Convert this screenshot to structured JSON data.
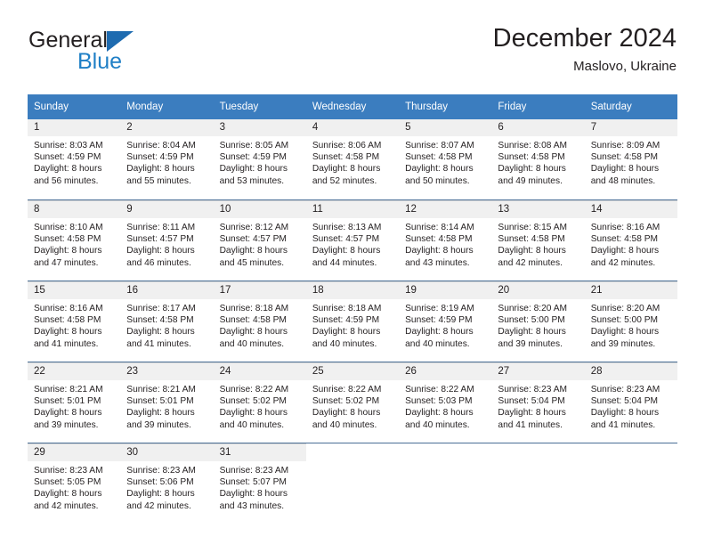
{
  "logo": {
    "word1": "General",
    "word2": "Blue",
    "triangle_color": "#1e6bb0",
    "blue_color": "#1f7fc6"
  },
  "header": {
    "title": "December 2024",
    "subtitle": "Maslovo, Ukraine"
  },
  "theme": {
    "header_row_bg": "#3b7dbf",
    "day_number_bg": "#f0f0f0",
    "week_separator": "#4a6f96",
    "text": "#231f20"
  },
  "weekday_headers": [
    "Sunday",
    "Monday",
    "Tuesday",
    "Wednesday",
    "Thursday",
    "Friday",
    "Saturday"
  ],
  "weeks": [
    [
      {
        "day": "1",
        "sunrise": "Sunrise: 8:03 AM",
        "sunset": "Sunset: 4:59 PM",
        "daylight1": "Daylight: 8 hours",
        "daylight2": "and 56 minutes."
      },
      {
        "day": "2",
        "sunrise": "Sunrise: 8:04 AM",
        "sunset": "Sunset: 4:59 PM",
        "daylight1": "Daylight: 8 hours",
        "daylight2": "and 55 minutes."
      },
      {
        "day": "3",
        "sunrise": "Sunrise: 8:05 AM",
        "sunset": "Sunset: 4:59 PM",
        "daylight1": "Daylight: 8 hours",
        "daylight2": "and 53 minutes."
      },
      {
        "day": "4",
        "sunrise": "Sunrise: 8:06 AM",
        "sunset": "Sunset: 4:58 PM",
        "daylight1": "Daylight: 8 hours",
        "daylight2": "and 52 minutes."
      },
      {
        "day": "5",
        "sunrise": "Sunrise: 8:07 AM",
        "sunset": "Sunset: 4:58 PM",
        "daylight1": "Daylight: 8 hours",
        "daylight2": "and 50 minutes."
      },
      {
        "day": "6",
        "sunrise": "Sunrise: 8:08 AM",
        "sunset": "Sunset: 4:58 PM",
        "daylight1": "Daylight: 8 hours",
        "daylight2": "and 49 minutes."
      },
      {
        "day": "7",
        "sunrise": "Sunrise: 8:09 AM",
        "sunset": "Sunset: 4:58 PM",
        "daylight1": "Daylight: 8 hours",
        "daylight2": "and 48 minutes."
      }
    ],
    [
      {
        "day": "8",
        "sunrise": "Sunrise: 8:10 AM",
        "sunset": "Sunset: 4:58 PM",
        "daylight1": "Daylight: 8 hours",
        "daylight2": "and 47 minutes."
      },
      {
        "day": "9",
        "sunrise": "Sunrise: 8:11 AM",
        "sunset": "Sunset: 4:57 PM",
        "daylight1": "Daylight: 8 hours",
        "daylight2": "and 46 minutes."
      },
      {
        "day": "10",
        "sunrise": "Sunrise: 8:12 AM",
        "sunset": "Sunset: 4:57 PM",
        "daylight1": "Daylight: 8 hours",
        "daylight2": "and 45 minutes."
      },
      {
        "day": "11",
        "sunrise": "Sunrise: 8:13 AM",
        "sunset": "Sunset: 4:57 PM",
        "daylight1": "Daylight: 8 hours",
        "daylight2": "and 44 minutes."
      },
      {
        "day": "12",
        "sunrise": "Sunrise: 8:14 AM",
        "sunset": "Sunset: 4:58 PM",
        "daylight1": "Daylight: 8 hours",
        "daylight2": "and 43 minutes."
      },
      {
        "day": "13",
        "sunrise": "Sunrise: 8:15 AM",
        "sunset": "Sunset: 4:58 PM",
        "daylight1": "Daylight: 8 hours",
        "daylight2": "and 42 minutes."
      },
      {
        "day": "14",
        "sunrise": "Sunrise: 8:16 AM",
        "sunset": "Sunset: 4:58 PM",
        "daylight1": "Daylight: 8 hours",
        "daylight2": "and 42 minutes."
      }
    ],
    [
      {
        "day": "15",
        "sunrise": "Sunrise: 8:16 AM",
        "sunset": "Sunset: 4:58 PM",
        "daylight1": "Daylight: 8 hours",
        "daylight2": "and 41 minutes."
      },
      {
        "day": "16",
        "sunrise": "Sunrise: 8:17 AM",
        "sunset": "Sunset: 4:58 PM",
        "daylight1": "Daylight: 8 hours",
        "daylight2": "and 41 minutes."
      },
      {
        "day": "17",
        "sunrise": "Sunrise: 8:18 AM",
        "sunset": "Sunset: 4:58 PM",
        "daylight1": "Daylight: 8 hours",
        "daylight2": "and 40 minutes."
      },
      {
        "day": "18",
        "sunrise": "Sunrise: 8:18 AM",
        "sunset": "Sunset: 4:59 PM",
        "daylight1": "Daylight: 8 hours",
        "daylight2": "and 40 minutes."
      },
      {
        "day": "19",
        "sunrise": "Sunrise: 8:19 AM",
        "sunset": "Sunset: 4:59 PM",
        "daylight1": "Daylight: 8 hours",
        "daylight2": "and 40 minutes."
      },
      {
        "day": "20",
        "sunrise": "Sunrise: 8:20 AM",
        "sunset": "Sunset: 5:00 PM",
        "daylight1": "Daylight: 8 hours",
        "daylight2": "and 39 minutes."
      },
      {
        "day": "21",
        "sunrise": "Sunrise: 8:20 AM",
        "sunset": "Sunset: 5:00 PM",
        "daylight1": "Daylight: 8 hours",
        "daylight2": "and 39 minutes."
      }
    ],
    [
      {
        "day": "22",
        "sunrise": "Sunrise: 8:21 AM",
        "sunset": "Sunset: 5:01 PM",
        "daylight1": "Daylight: 8 hours",
        "daylight2": "and 39 minutes."
      },
      {
        "day": "23",
        "sunrise": "Sunrise: 8:21 AM",
        "sunset": "Sunset: 5:01 PM",
        "daylight1": "Daylight: 8 hours",
        "daylight2": "and 39 minutes."
      },
      {
        "day": "24",
        "sunrise": "Sunrise: 8:22 AM",
        "sunset": "Sunset: 5:02 PM",
        "daylight1": "Daylight: 8 hours",
        "daylight2": "and 40 minutes."
      },
      {
        "day": "25",
        "sunrise": "Sunrise: 8:22 AM",
        "sunset": "Sunset: 5:02 PM",
        "daylight1": "Daylight: 8 hours",
        "daylight2": "and 40 minutes."
      },
      {
        "day": "26",
        "sunrise": "Sunrise: 8:22 AM",
        "sunset": "Sunset: 5:03 PM",
        "daylight1": "Daylight: 8 hours",
        "daylight2": "and 40 minutes."
      },
      {
        "day": "27",
        "sunrise": "Sunrise: 8:23 AM",
        "sunset": "Sunset: 5:04 PM",
        "daylight1": "Daylight: 8 hours",
        "daylight2": "and 41 minutes."
      },
      {
        "day": "28",
        "sunrise": "Sunrise: 8:23 AM",
        "sunset": "Sunset: 5:04 PM",
        "daylight1": "Daylight: 8 hours",
        "daylight2": "and 41 minutes."
      }
    ],
    [
      {
        "day": "29",
        "sunrise": "Sunrise: 8:23 AM",
        "sunset": "Sunset: 5:05 PM",
        "daylight1": "Daylight: 8 hours",
        "daylight2": "and 42 minutes."
      },
      {
        "day": "30",
        "sunrise": "Sunrise: 8:23 AM",
        "sunset": "Sunset: 5:06 PM",
        "daylight1": "Daylight: 8 hours",
        "daylight2": "and 42 minutes."
      },
      {
        "day": "31",
        "sunrise": "Sunrise: 8:23 AM",
        "sunset": "Sunset: 5:07 PM",
        "daylight1": "Daylight: 8 hours",
        "daylight2": "and 43 minutes."
      },
      {
        "day": "",
        "sunrise": "",
        "sunset": "",
        "daylight1": "",
        "daylight2": ""
      },
      {
        "day": "",
        "sunrise": "",
        "sunset": "",
        "daylight1": "",
        "daylight2": ""
      },
      {
        "day": "",
        "sunrise": "",
        "sunset": "",
        "daylight1": "",
        "daylight2": ""
      },
      {
        "day": "",
        "sunrise": "",
        "sunset": "",
        "daylight1": "",
        "daylight2": ""
      }
    ]
  ]
}
